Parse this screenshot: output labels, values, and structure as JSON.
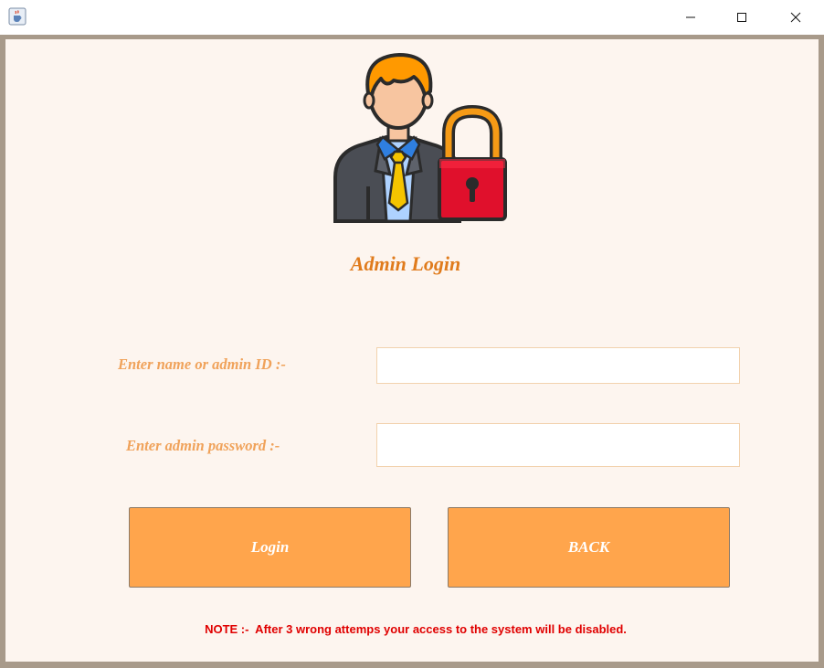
{
  "window": {
    "icon": "java-cup-icon",
    "controls": {
      "minimize": "minimize-icon",
      "maximize": "maximize-icon",
      "close": "close-icon"
    }
  },
  "login": {
    "image": "admin-with-padlock-icon",
    "title": "Admin Login",
    "id_label": "Enter name or admin ID :-",
    "id_value": "",
    "password_label": "Enter admin password :-",
    "password_value": "",
    "login_button": "Login",
    "back_button": "BACK",
    "note": "NOTE :-  After 3 wrong attemps your access to the system will be disabled."
  },
  "colors": {
    "background": "#fdf5ef",
    "frame": "#a89a8a",
    "title": "#e07b1c",
    "labels": "#f0a25a",
    "buttons": "#ffa54c",
    "note": "#e00000"
  }
}
